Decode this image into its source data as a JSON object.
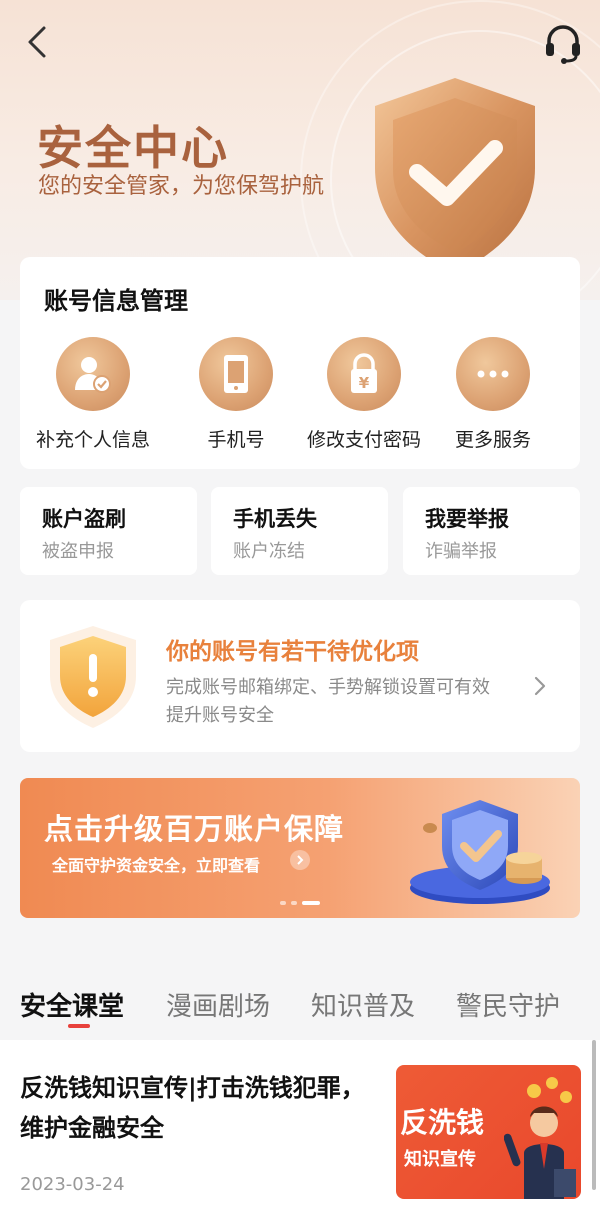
{
  "header": {
    "title": "安全中心",
    "subtitle": "您的安全管家，为您保驾护航",
    "back_icon": "chevron-left-icon",
    "support_icon": "headset-icon"
  },
  "account_section": {
    "title": "账号信息管理",
    "items": [
      {
        "label": "补充个人信息",
        "icon": "user-check-icon"
      },
      {
        "label": "手机号",
        "icon": "phone-icon"
      },
      {
        "label": "修改支付密码",
        "icon": "lock-yuan-icon"
      },
      {
        "label": "更多服务",
        "icon": "more-dots-icon"
      }
    ]
  },
  "quick_actions": [
    {
      "title": "账户盗刷",
      "subtitle": "被盗申报"
    },
    {
      "title": "手机丢失",
      "subtitle": "账户冻结"
    },
    {
      "title": "我要举报",
      "subtitle": "诈骗举报"
    }
  ],
  "optimization": {
    "title": "你的账号有若干待优化项",
    "description": "完成账号邮箱绑定、手势解锁设置可有效提升账号安全",
    "icon": "warning-shield-icon"
  },
  "banner": {
    "title": "点击升级百万账户保障",
    "subtitle": "全面守护资金安全，立即查看",
    "slide_count": 3,
    "active_slide": 3
  },
  "tabs": [
    {
      "label": "安全课堂",
      "active": true
    },
    {
      "label": "漫画剧场",
      "active": false
    },
    {
      "label": "知识普及",
      "active": false
    },
    {
      "label": "警民守护",
      "active": false
    }
  ],
  "article": {
    "title": "反洗钱知识宣传|打击洗钱犯罪，维护金融安全",
    "date": "2023-03-24",
    "thumb_title": "反洗钱",
    "thumb_subtitle": "知识宣传"
  },
  "colors": {
    "brand_brown": "#a9623e",
    "accent_orange": "#e8813c",
    "tab_indicator": "#e8413c"
  }
}
